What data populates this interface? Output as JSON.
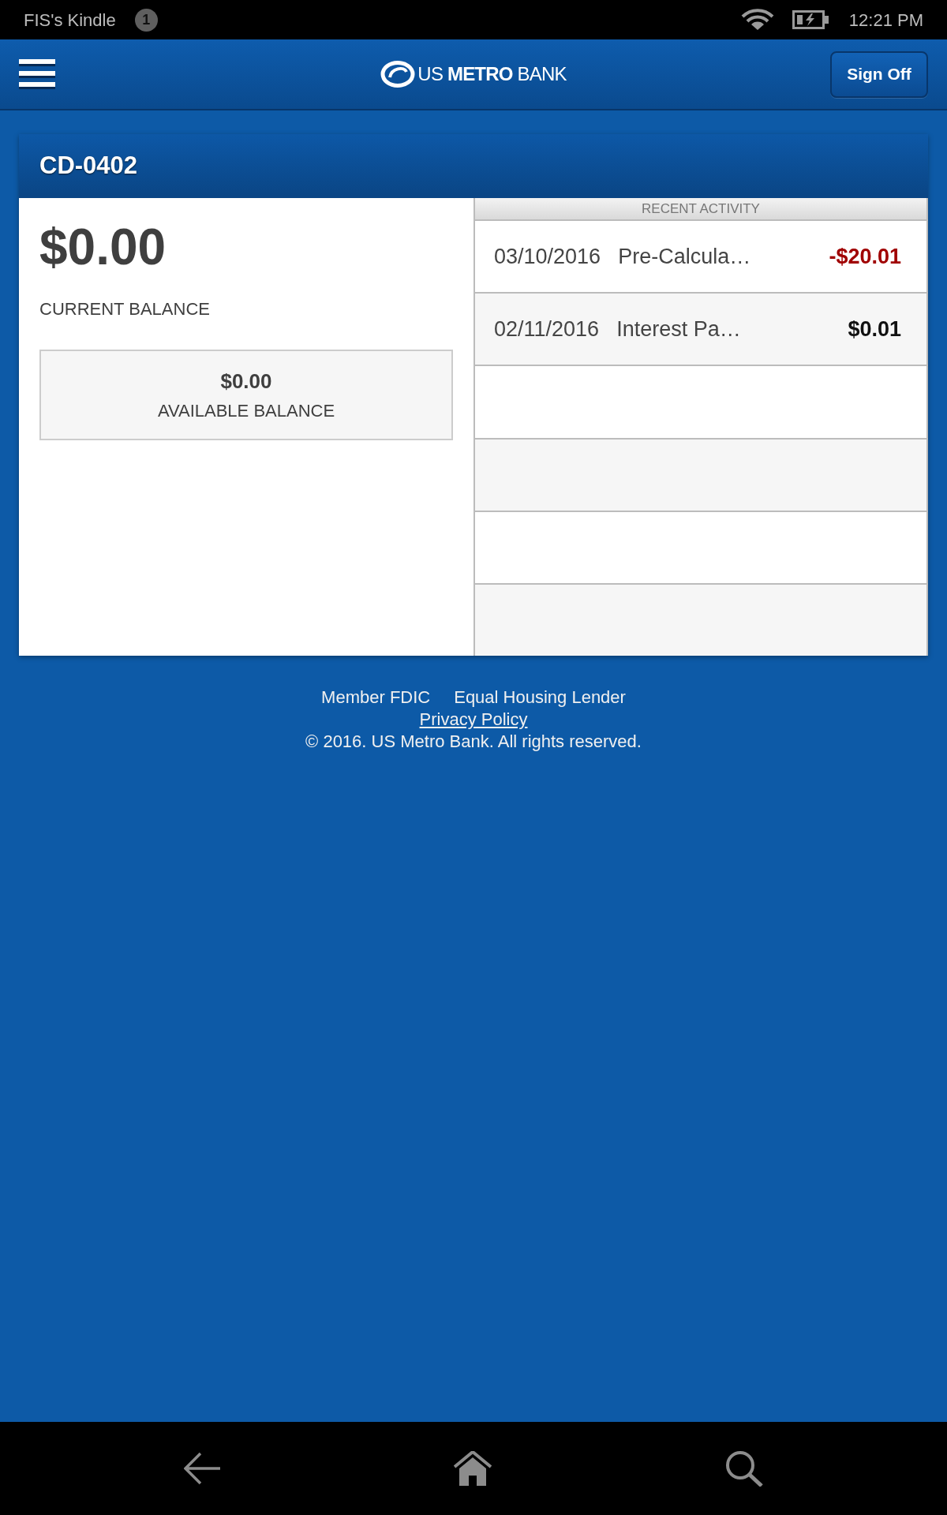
{
  "status_bar": {
    "device_name": "FIS's Kindle",
    "notification_count": "1",
    "time": "12:21 PM"
  },
  "header": {
    "logo": "US **METRO** BANK",
    "sign_off_button": "Sign Off"
  },
  "account": {
    "title": "CD-0402",
    "current_balance": "$0.00",
    "current_balance_label": "CURRENT BALANCE",
    "available_balance": "$0.00",
    "available_balance_label": "AVAILABLE BALANCE"
  },
  "recent_activity": {
    "title": "RECENT ACTIVITY",
    "rows": [
      {
        "date": "03/10/2016",
        "description": "Pre-Calcula…",
        "amount": "-$20.01",
        "kind": "debit"
      },
      {
        "date": "02/11/2016",
        "description": "Interest Pa…",
        "amount": "$0.01",
        "kind": "credit"
      }
    ]
  },
  "footer": {
    "notices": [
      "Member FDIC",
      "Equal Housing Lender"
    ],
    "privacy_link": "Privacy Policy",
    "copyright": "© 2016. US Metro Bank. All rights reserved."
  }
}
